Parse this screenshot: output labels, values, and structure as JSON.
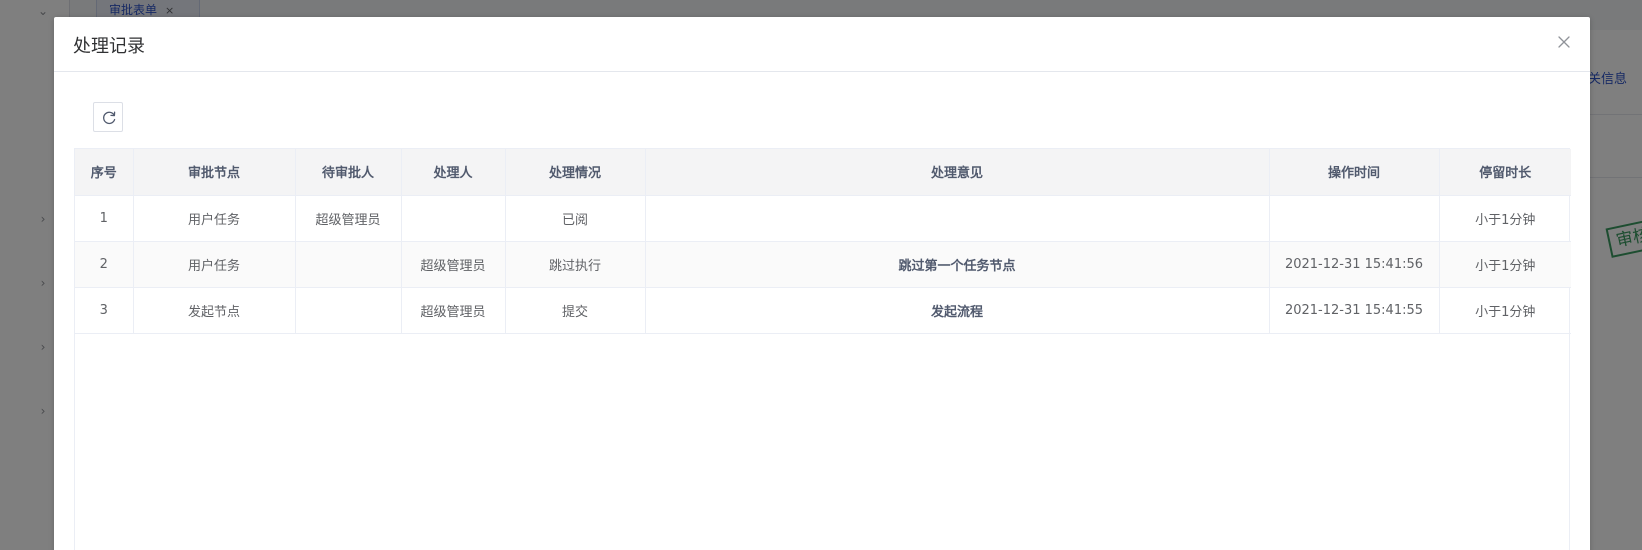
{
  "background": {
    "tab_label": "审批表单",
    "tab_close": "×",
    "right_link": "关信息",
    "stamp_text": "审核"
  },
  "dialog": {
    "title": "处理记录",
    "close_icon": "close-icon",
    "refresh_icon": "refresh-icon"
  },
  "table": {
    "headers": [
      "序号",
      "审批节点",
      "待审批人",
      "处理人",
      "处理情况",
      "处理意见",
      "操作时间",
      "停留时长"
    ],
    "rows": [
      [
        "1",
        "用户任务",
        "超级管理员",
        "",
        "已阅",
        "",
        "",
        "小于1分钟"
      ],
      [
        "2",
        "用户任务",
        "",
        "超级管理员",
        "跳过执行",
        "跳过第一个任务节点",
        "2021-12-31 15:41:56",
        "小于1分钟"
      ],
      [
        "3",
        "发起节点",
        "",
        "超级管理员",
        "提交",
        "发起流程",
        "2021-12-31 15:41:55",
        "小于1分钟"
      ]
    ]
  },
  "colors": {
    "accent": "#2f54c8",
    "stamp": "#3a9b61"
  }
}
